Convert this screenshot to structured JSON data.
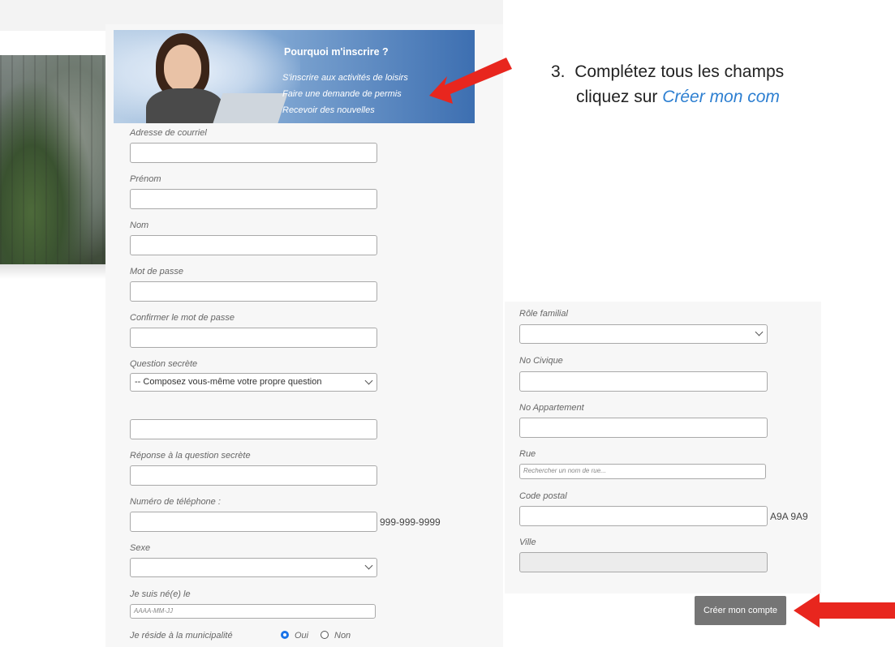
{
  "banner": {
    "title": "Pourquoi m'inscrire ?",
    "links": [
      "S'inscrire aux activités de loisirs",
      "Faire une demande de permis",
      "Recevoir des nouvelles"
    ]
  },
  "instruction": {
    "number": "3.",
    "line1": "Complétez tous les champs",
    "line2_prefix": "cliquez sur ",
    "line2_link": "Créer mon com"
  },
  "form_left": {
    "email_label": "Adresse de courriel",
    "firstname_label": "Prénom",
    "lastname_label": "Nom",
    "password_label": "Mot de passe",
    "confirm_password_label": "Confirmer le mot de passe",
    "secret_question_label": "Question secrète",
    "secret_question_selected": "-- Composez vous-même votre propre question",
    "secret_answer_label": "Réponse à la question secrète",
    "phone_label": "Numéro de téléphone :",
    "phone_hint": "999-999-9999",
    "sex_label": "Sexe",
    "birth_label": "Je suis né(e) le",
    "birth_placeholder": "AAAA-MM-JJ",
    "resident_label": "Je réside à la municipalité",
    "resident_yes": "Oui",
    "resident_no": "Non"
  },
  "form_right": {
    "family_role_label": "Rôle familial",
    "civic_label": "No Civique",
    "apartment_label": "No Appartement",
    "street_label": "Rue",
    "street_placeholder": "Rechercher un nom de rue...",
    "postal_label": "Code postal",
    "postal_hint": "A9A 9A9",
    "city_label": "Ville"
  },
  "create_button": "Créer mon compte",
  "colors": {
    "arrow": "#e8261e",
    "link_blue": "#2d7fd1",
    "button_gray": "#757575",
    "radio_blue": "#1a73e8"
  }
}
